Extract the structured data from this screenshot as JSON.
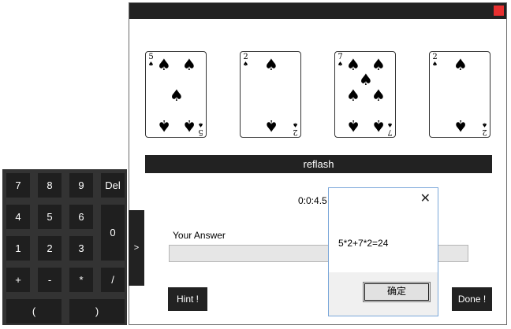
{
  "window": {
    "cards": [
      {
        "rank": "5",
        "suit": "♠"
      },
      {
        "rank": "2",
        "suit": "♠"
      },
      {
        "rank": "7",
        "suit": "♠"
      },
      {
        "rank": "2",
        "suit": "♠"
      }
    ],
    "reflash_label": "reflash",
    "timer": "0:0:4.5",
    "answer_label": "Your Answer",
    "answer_value": "",
    "hint_label": "Hint !",
    "done_label": "Done !",
    "close_color": "#e83030"
  },
  "keypad": {
    "keys": {
      "k7": "7",
      "k8": "8",
      "k9": "9",
      "del": "Del",
      "k4": "4",
      "k5": "5",
      "k6": "6",
      "k0": "0",
      "k1": "1",
      "k2": "2",
      "k3": "3",
      "plus": "+",
      "minus": "-",
      "times": "*",
      "divide": "/",
      "lparen": "(",
      "rparen": ")"
    },
    "toggle_label": ">"
  },
  "dialog": {
    "close_glyph": "✕",
    "message": "5*2+7*2=24",
    "ok_label": "确定"
  }
}
